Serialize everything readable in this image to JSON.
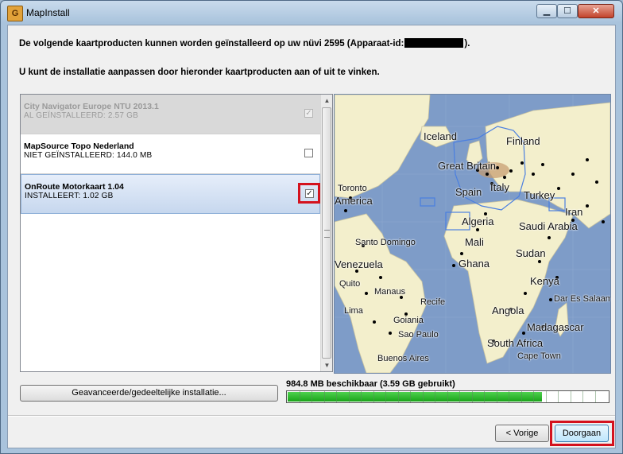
{
  "window": {
    "title": "MapInstall",
    "app_icon": "G",
    "controls": {
      "minimize": "▁",
      "maximize": "☐",
      "close": "✕"
    }
  },
  "instructions": {
    "line1_prefix": "De volgende kaartproducten kunnen worden geïnstalleerd op uw nüvi 2595 (Apparaat-id:",
    "line1_suffix": ").",
    "line2": "U kunt de installatie aanpassen door hieronder kaartproducten aan of uit te vinken."
  },
  "products": [
    {
      "name": "City Navigator Europe NTU 2013.1",
      "status": "AL GEÏNSTALLEERD: 2.57 GB",
      "checked": true,
      "state": "installed"
    },
    {
      "name": "MapSource Topo Nederland",
      "status": "NIET GEÏNSTALLEERD: 144.0 MB",
      "checked": false,
      "state": "normal"
    },
    {
      "name": "OnRoute Motorkaart 1.04",
      "status": "INSTALLEERT: 1.02 GB",
      "checked": true,
      "state": "selected"
    }
  ],
  "check_glyph": "✓",
  "scroll": {
    "up": "▲",
    "down": "▼"
  },
  "map": {
    "labels": [
      "Iceland",
      "Finland",
      "Great Britain",
      "Spain",
      "Italy",
      "Turkey",
      "Toronto",
      "America",
      "Algeria",
      "Iran",
      "Saudi Arabia",
      "Santo Domingo",
      "Mali",
      "Sudan",
      "Venezuela",
      "Ghana",
      "Quito",
      "Manaus",
      "Kenya",
      "Recife",
      "Dar Es Salaam",
      "Lima",
      "Goiania",
      "Angola",
      "Sao Paulo",
      "Madagascar",
      "Buenos Aires",
      "South Africa",
      "Cape Town"
    ]
  },
  "colors": {
    "ocean": "#7e9cc8",
    "land": "#f3efcc",
    "highlight": "#d4121e",
    "progress": "#22b022"
  },
  "advanced_button": "Geavanceerde/gedeeltelijke installatie...",
  "storage": {
    "label": "984.8 MB beschikbaar (3.59 GB gebruikt)",
    "used_fraction": 0.795,
    "segments": 26
  },
  "buttons": {
    "prev": "< Vorige",
    "next": "Doorgaan"
  }
}
